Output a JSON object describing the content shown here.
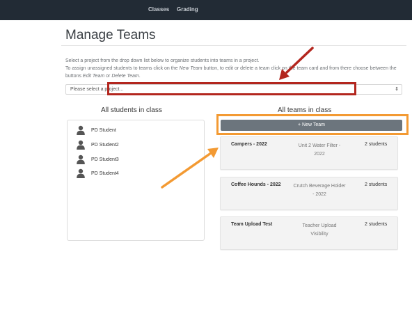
{
  "nav": {
    "items": [
      {
        "label": "Classes"
      },
      {
        "label": "Grading"
      }
    ]
  },
  "page": {
    "title": "Manage Teams"
  },
  "instructions": {
    "line1": "Select a project from the drop down list below to organize students into teams in a project.",
    "line2_a": "To assign unassigned students to teams click on the ",
    "line2_new_team": "New Team",
    "line2_b": " button, to edit or delete a team click on the team card and from there choose between the",
    "line3_a": "buttons ",
    "line3_edit": "Edit Team",
    "line3_or": " or ",
    "line3_delete": "Delete Team",
    "line3_end": "."
  },
  "project_select": {
    "selected": "Please select a project..."
  },
  "students": {
    "heading": "All students in class",
    "items": [
      {
        "name": "PD Student"
      },
      {
        "name": "PD Student2"
      },
      {
        "name": "PD Student3"
      },
      {
        "name": "PD Student4"
      }
    ]
  },
  "teams": {
    "heading": "All teams in class",
    "new_team_label": "+ New Team",
    "cards": [
      {
        "name": "Campers - 2022",
        "project_line1": "Unit 2 Water Filter -",
        "project_line2": "2022",
        "count": "2 students"
      },
      {
        "name": "Coffee Hounds - 2022",
        "project_line1": "Crutch Beverage Holder",
        "project_line2": "- 2022",
        "count": "2 students"
      },
      {
        "name": "Team Upload Test",
        "project_line1": "Teacher Upload",
        "project_line2": "Visibility",
        "count": "2 students"
      }
    ]
  },
  "annotations": {
    "red_color": "#b3261e",
    "orange_color": "#f39a33"
  },
  "icons": {
    "student": "person-icon",
    "select_caret": "sort-caret-icon"
  }
}
